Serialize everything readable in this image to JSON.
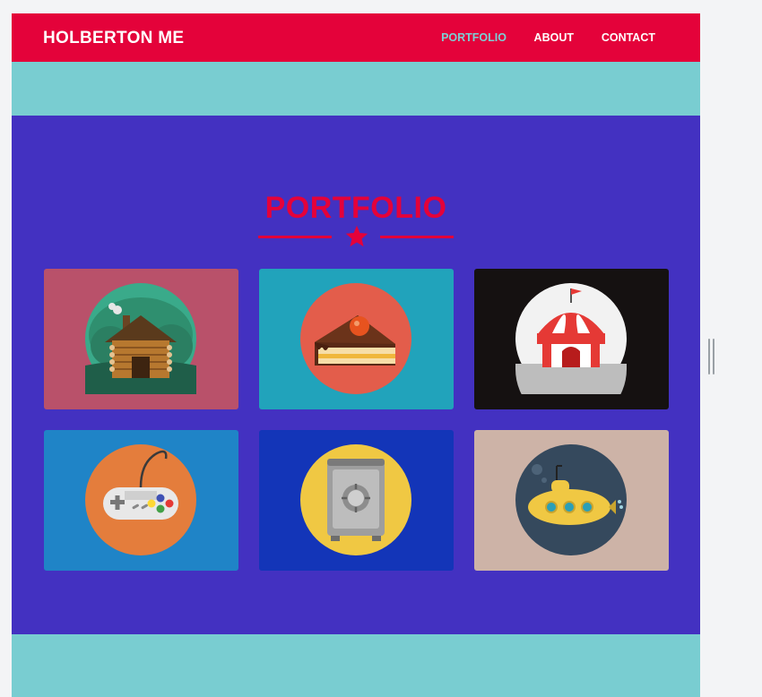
{
  "header": {
    "brand": "HOLBERTON ME",
    "nav": [
      {
        "label": "PORTFOLIO",
        "active": true
      },
      {
        "label": "ABOUT",
        "active": false
      },
      {
        "label": "CONTACT",
        "active": false
      }
    ]
  },
  "portfolio": {
    "title": "PORTFOLIO",
    "divider_icon": "star-icon",
    "items": [
      {
        "icon": "cabin-icon",
        "card_color": "#b9516a",
        "circle_color": "#3aaa8a"
      },
      {
        "icon": "cake-icon",
        "card_color": "#21a3bb",
        "circle_color": "#e35d4b"
      },
      {
        "icon": "circus-tent-icon",
        "card_color": "#151111",
        "circle_color": "#f2f2f2"
      },
      {
        "icon": "game-controller-icon",
        "card_color": "#1f84c7",
        "circle_color": "#e47d3c"
      },
      {
        "icon": "safe-icon",
        "card_color": "#1335b8",
        "circle_color": "#f0c843"
      },
      {
        "icon": "submarine-icon",
        "card_color": "#cdb3a7",
        "circle_color": "#35495d"
      }
    ]
  },
  "colors": {
    "accent": "#e4023a",
    "teal": "#79cdd1",
    "section_bg": "#4331c1",
    "nav_active": "#7ecfd4"
  }
}
